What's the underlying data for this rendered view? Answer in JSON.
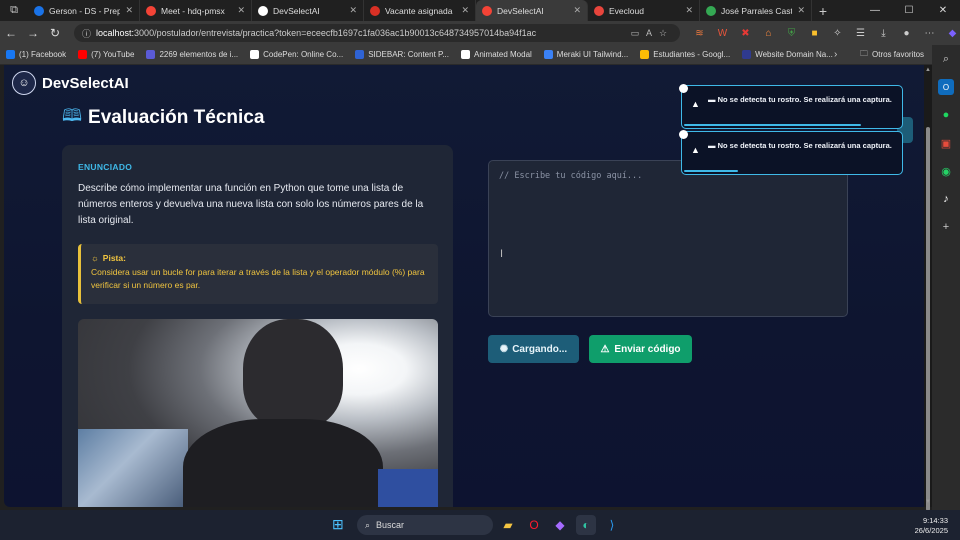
{
  "browser": {
    "tabs": [
      {
        "label": "Gerson - DS - Prepara",
        "favicon_color": "#1a73e8",
        "active": false
      },
      {
        "label": "Meet - hdq-pmsx",
        "favicon_color": "#f44336",
        "active": false
      },
      {
        "label": "DevSelectAI",
        "favicon_color": "#ffffff",
        "active": false
      },
      {
        "label": "Vacante asignada",
        "favicon_color": "#d93025",
        "active": false
      },
      {
        "label": "DevSelectAI",
        "favicon_color": "#f44336",
        "active": true
      },
      {
        "label": "Evecloud",
        "favicon_color": "#e8453c",
        "active": false
      },
      {
        "label": "José Parrales Castro A",
        "favicon_color": "#34a853",
        "active": false
      }
    ],
    "url_host": "localhost:",
    "url_path": "3000/postulador/entrevista/practica?token=eceecfb1697c1fa036ac1b90013c648734957014ba94f1ac",
    "bookmarks": [
      {
        "label": "(1) Facebook",
        "color": "#1877f2"
      },
      {
        "label": "(7) YouTube",
        "color": "#ff0000"
      },
      {
        "label": "2269 elementos de i...",
        "color": "#5b5bd6"
      },
      {
        "label": "CodePen: Online Co...",
        "color": "#ffffff"
      },
      {
        "label": "SIDEBAR: Content P...",
        "color": "#2f63d4"
      },
      {
        "label": "Animated Modal",
        "color": "#ffffff"
      },
      {
        "label": "Meraki UI Tailwind...",
        "color": "#3b82f6"
      },
      {
        "label": "Estudiantes - Googl...",
        "color": "#fbbc05"
      },
      {
        "label": "Website Domain Na...",
        "color": "#2f3a8f"
      }
    ],
    "bookmarks_other": "Otros favoritos"
  },
  "app": {
    "brand": "DevSelectAI",
    "page_title": "Evaluación Técnica",
    "statement_label": "ENUNCIADO",
    "statement_text": "Describe cómo implementar una función en Python que tome una lista de números enteros y devuelva una nueva lista con solo los números pares de la lista original.",
    "hint_label": "Pista:",
    "hint_text": "Considera usar un bucle for para iterar a través de la lista y el operador módulo (%) para verificar si un número es par.",
    "editor_placeholder": "// Escribe tu código aquí...",
    "loading_button": "Cargando...",
    "send_button": "Enviar código"
  },
  "toasts": [
    {
      "message": "No se detecta tu rostro. Se realizará una captura.",
      "progress": 0.82
    },
    {
      "message": "No se detecta tu rostro. Se realizará una captura.",
      "progress": 0.25
    }
  ],
  "taskbar": {
    "search_label": "Buscar",
    "time": "9:14:33",
    "date": "26/6/2025"
  },
  "colors": {
    "accent_cyan": "#3fb9e8",
    "hint_yellow": "#f1c53f",
    "send_green": "#0f9e6b",
    "loading_blue": "#1d5d78"
  }
}
